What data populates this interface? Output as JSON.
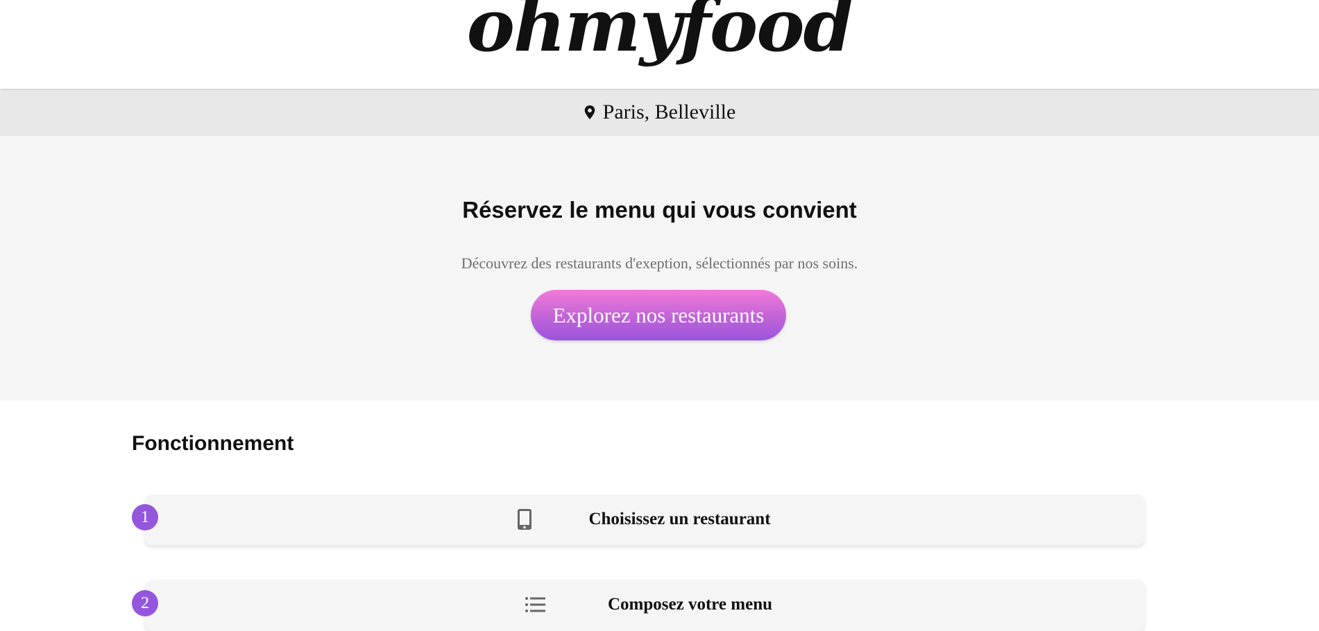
{
  "header": {
    "logo_text": "ohmyfood"
  },
  "location": {
    "icon": "map-pin-icon",
    "text": "Paris, Belleville"
  },
  "hero": {
    "title": "Réservez le menu qui vous convient",
    "subtitle": "Découvrez des restaurants d'exeption, sélectionnés par nos soins.",
    "cta_label": "Explorez nos restaurants"
  },
  "how_it_works": {
    "title": "Fonctionnement",
    "steps": [
      {
        "number": "1",
        "icon": "mobile-phone-icon",
        "label": "Choisissez un restaurant"
      },
      {
        "number": "2",
        "icon": "list-icon",
        "label": "Composez votre menu"
      }
    ]
  },
  "colors": {
    "accent_purple": "#9356dc",
    "cta_gradient_top": "#f27ad8",
    "cta_gradient_bottom": "#9a55db",
    "location_bar_bg": "#e8e8e8",
    "hero_bg": "#f5f5f5"
  }
}
